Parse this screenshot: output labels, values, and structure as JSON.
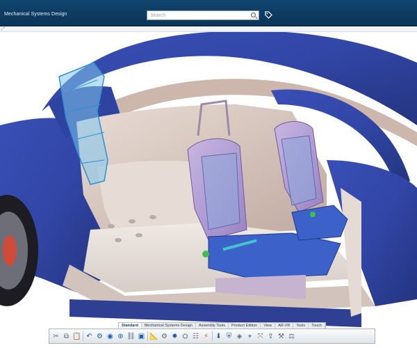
{
  "titlebar": {
    "app_title": "Mechanical Systems Design",
    "search_placeholder": "Search"
  },
  "action_bar": {
    "tabs": [
      {
        "label": "Standard",
        "active": true
      },
      {
        "label": "Mechanical Systems Design",
        "active": false
      },
      {
        "label": "Assembly Tools",
        "active": false
      },
      {
        "label": "Product Edition",
        "active": false
      },
      {
        "label": "View",
        "active": false
      },
      {
        "label": "AR-VR",
        "active": false
      },
      {
        "label": "Tools",
        "active": false
      },
      {
        "label": "Touch",
        "active": false
      }
    ],
    "tools": [
      {
        "name": "cut-icon",
        "glyph": "✂",
        "tone": "gray"
      },
      {
        "name": "copy-icon",
        "glyph": "⧉",
        "tone": "gray"
      },
      {
        "name": "paste-icon",
        "glyph": "📋",
        "tone": "gray"
      },
      {
        "name": "undo-icon",
        "glyph": "↶",
        "tone": "blue"
      },
      {
        "name": "settings-icon",
        "glyph": "⚙",
        "tone": "blue"
      },
      {
        "name": "assembly-icon",
        "glyph": "◉",
        "tone": "blue"
      },
      {
        "name": "constraint-icon",
        "glyph": "⊕",
        "tone": "blue"
      },
      {
        "name": "link-icon",
        "glyph": "⛓",
        "tone": "gray"
      },
      {
        "name": "part-icon",
        "glyph": "▣",
        "tone": "blue"
      },
      {
        "name": "measure-icon",
        "glyph": "📐",
        "tone": "orange"
      },
      {
        "name": "gear-icon",
        "glyph": "⚙",
        "tone": "gray"
      },
      {
        "name": "explode-icon",
        "glyph": "✹",
        "tone": "blue"
      },
      {
        "name": "mechanism-icon",
        "glyph": "⛭",
        "tone": "gray"
      },
      {
        "name": "tree-icon",
        "glyph": "☷",
        "tone": "gray"
      },
      {
        "name": "clash-icon",
        "glyph": "⚡",
        "tone": "orange"
      },
      {
        "name": "save-icon",
        "glyph": "⬇",
        "tone": "blue"
      },
      {
        "name": "shield-icon",
        "glyph": "⛨",
        "tone": "blue"
      },
      {
        "name": "analysis-icon",
        "glyph": "◈",
        "tone": "gray"
      },
      {
        "name": "snap-icon",
        "glyph": "⌖",
        "tone": "blue"
      },
      {
        "name": "transform-icon",
        "glyph": "⤧",
        "tone": "gray"
      },
      {
        "name": "share-icon",
        "glyph": "⇪",
        "tone": "blue"
      },
      {
        "name": "robot-icon",
        "glyph": "⚒",
        "tone": "gray"
      },
      {
        "name": "scale-icon",
        "glyph": "⚖",
        "tone": "gray"
      }
    ]
  },
  "colors": {
    "titlebar": "#0b3458",
    "car_body": "#3147a8",
    "interior": "#d9c6bd",
    "seat_frame": "#b9a2d8",
    "seat_pan": "#3b60c8",
    "highlight_part": "#5fb4e8"
  }
}
